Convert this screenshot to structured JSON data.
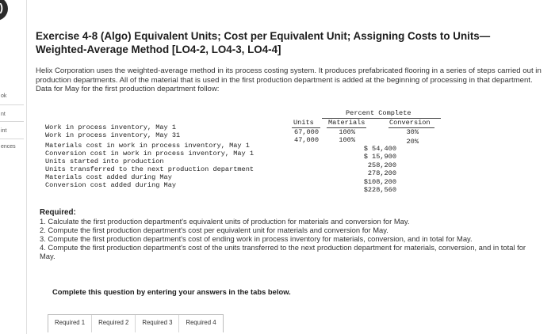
{
  "sidebar": {
    "nav_glyph": ")",
    "labels": [
      "ok",
      "nt",
      "int",
      "ences"
    ]
  },
  "title": "Exercise 4-8 (Algo) Equivalent Units; Cost per Equivalent Unit; Assigning Costs to Units—Weighted-Average Method [LO4-2, LO4-3, LO4-4]",
  "intro": "Helix Corporation uses the weighted-average method in its process costing system. It produces prefabricated flooring in a series of steps carried out in production departments. All of the material that is used in the first production department is added at the beginning of processing in that department. Data for May for the first production department follow:",
  "table": {
    "header_top": "Percent Complete",
    "col_units": "Units",
    "col_materials": "Materials",
    "col_conversion": "Conversion",
    "rows": [
      {
        "label": "Work in process inventory, May 1",
        "units": "67,000",
        "materials": "100%",
        "conversion": "30%",
        "amount": ""
      },
      {
        "label": "Work in process inventory, May 31",
        "units": "47,000",
        "materials": "100%",
        "conversion": "20%",
        "amount": ""
      },
      {
        "label": "Materials cost in work in process inventory, May 1",
        "units": "",
        "materials": "",
        "conversion": "",
        "amount": "$ 54,400"
      },
      {
        "label": "Conversion cost in work in process inventory, May 1",
        "units": "",
        "materials": "",
        "conversion": "",
        "amount": "$ 15,900"
      },
      {
        "label": "Units started into production",
        "units": "",
        "materials": "",
        "conversion": "",
        "amount": "258,200"
      },
      {
        "label": "Units transferred to the next production department",
        "units": "",
        "materials": "",
        "conversion": "",
        "amount": "278,200"
      },
      {
        "label": "Materials cost added during May",
        "units": "",
        "materials": "",
        "conversion": "",
        "amount": "$108,200"
      },
      {
        "label": "Conversion cost added during May",
        "units": "",
        "materials": "",
        "conversion": "",
        "amount": "$228,560"
      }
    ]
  },
  "required": {
    "heading": "Required:",
    "items": [
      "1. Calculate the first production department's equivalent units of production for materials and conversion for May.",
      "2. Compute the first production department's cost per equivalent unit for materials and conversion for May.",
      "3. Compute the first production department's cost of ending work in process inventory for materials, conversion, and in total for May.",
      "4. Compute the first production department's cost of the units transferred to the next production department for materials, conversion, and in total for May."
    ]
  },
  "instruction": "Complete this question by entering your answers in the tabs below.",
  "tabs": [
    "Required 1",
    "Required 2",
    "Required 3",
    "Required 4"
  ]
}
